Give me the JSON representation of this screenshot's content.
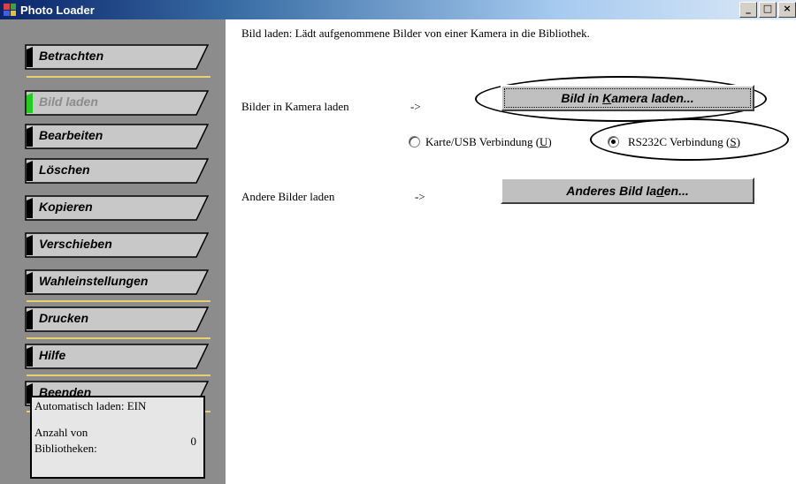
{
  "window": {
    "title": "Photo Loader",
    "controls": {
      "minimize": "_",
      "maximize": "□",
      "close": "×"
    }
  },
  "sidebar": {
    "items": [
      {
        "label": "Betrachten",
        "active": false
      },
      {
        "label": "Bild laden",
        "active": true
      },
      {
        "label": "Bearbeiten",
        "active": false
      },
      {
        "label": "Löschen",
        "active": false
      },
      {
        "label": "Kopieren",
        "active": false
      },
      {
        "label": "Verschieben",
        "active": false
      },
      {
        "label": "Wahleinstellungen",
        "active": false
      },
      {
        "label": "Drucken",
        "active": false
      },
      {
        "label": "Hilfe",
        "active": false
      },
      {
        "label": "Beenden",
        "active": false
      }
    ],
    "info": {
      "auto_load": "Automatisch laden: EIN",
      "library_count_label_1": "Anzahl von",
      "library_count_label_2": "Bibliotheken:",
      "library_count": "0"
    }
  },
  "main": {
    "description": "Bild laden: Lädt aufgenommene Bilder von einer Kamera in die Bibliothek.",
    "camera_row": {
      "label": "Bilder in Kamera laden",
      "arrow": "->",
      "button_pre": "Bild in ",
      "button_mnemonic": "K",
      "button_post": "amera laden..."
    },
    "connection": {
      "option1_pre": "Karte/USB Verbindung (",
      "option1_key": "U",
      "option1_post": ")",
      "option2_pre": "RS232C Verbindung (",
      "option2_key": "S",
      "option2_post": ")",
      "selected": "RS232C Verbindung (S)"
    },
    "other_row": {
      "label": "Andere Bilder laden",
      "arrow": "->",
      "button_pre": "Anderes Bild la",
      "button_mnemonic": "d",
      "button_post": "en..."
    }
  },
  "colors": {
    "titlebar_start": "#0a246a",
    "sidebar_bg": "#8c8c8c",
    "active_marker": "#22cc22",
    "separator": "#e8d070"
  }
}
